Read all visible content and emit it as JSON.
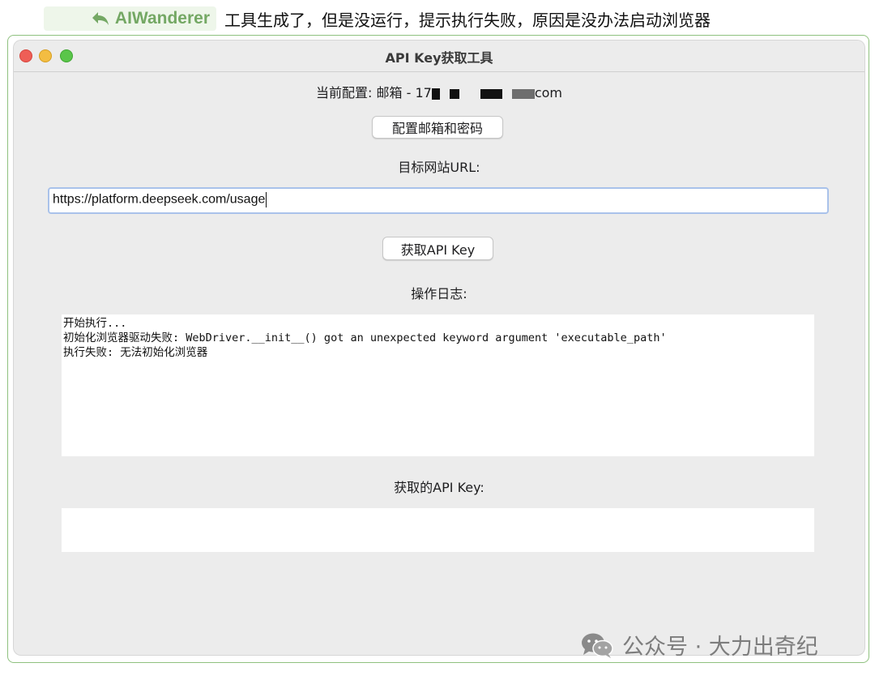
{
  "reply": {
    "author": "AIWanderer",
    "text": "工具生成了，但是没运行，提示执行失败，原因是没办法启动浏览器"
  },
  "window": {
    "title": "API Key获取工具"
  },
  "config": {
    "label_prefix": "当前配置: 邮箱 - 17",
    "label_suffix": "com"
  },
  "buttons": {
    "configure": "配置邮箱和密码",
    "fetch": "获取API Key"
  },
  "url_section": {
    "label": "目标网站URL:",
    "value": "https://platform.deepseek.com/usage"
  },
  "log_section": {
    "label": "操作日志:",
    "lines": [
      "开始执行...",
      "初始化浏览器驱动失败: WebDriver.__init__() got an unexpected keyword argument 'executable_path'",
      "执行失败: 无法初始化浏览器"
    ]
  },
  "key_section": {
    "label": "获取的API Key:",
    "value": ""
  },
  "watermark": {
    "text": "公众号 · 大力出奇纪",
    "icon": "wechat-icon"
  },
  "colors": {
    "accent_green": "#74a864",
    "input_focus": "#a9c2ea"
  }
}
